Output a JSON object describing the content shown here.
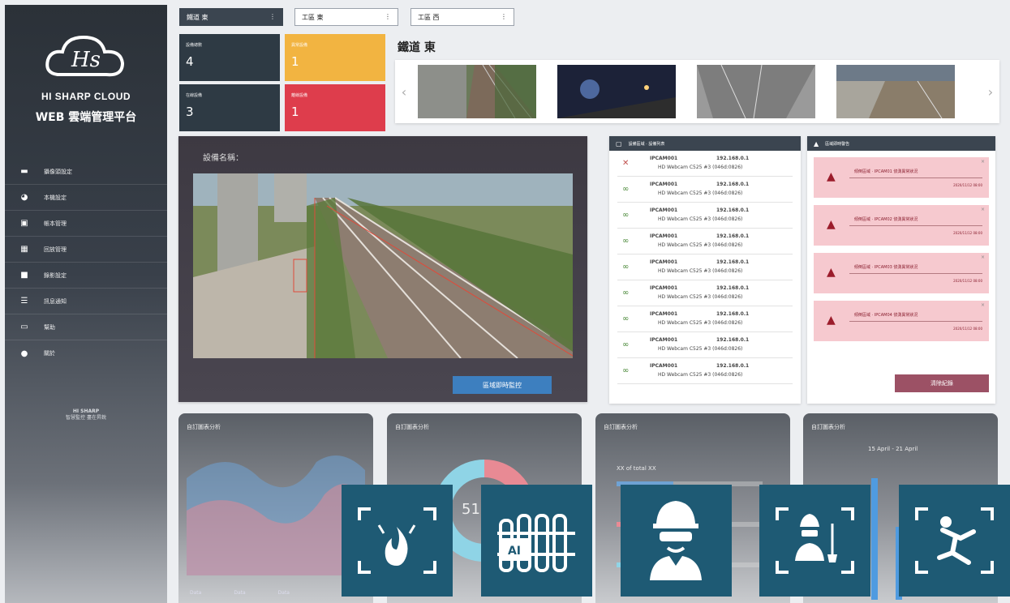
{
  "sidebar": {
    "brand": "HI SHARP CLOUD",
    "platform": "WEB 雲端管理平台",
    "menu": [
      {
        "label": "攝像頭設定",
        "icon": "camera-settings-icon"
      },
      {
        "label": "本機設定",
        "icon": "gauge-icon"
      },
      {
        "label": "帳本管理",
        "icon": "inbox-icon"
      },
      {
        "label": "回放管理",
        "icon": "image-icon"
      },
      {
        "label": "錄影設定",
        "icon": "video-camera-icon"
      },
      {
        "label": "訊息通知",
        "icon": "list-icon"
      },
      {
        "label": "幫助",
        "icon": "help-icon"
      },
      {
        "label": "關於",
        "icon": "info-icon"
      }
    ],
    "footer_brand": "HI SHARP",
    "footer_sub": "智慧監控 盡在昇銳"
  },
  "filters": {
    "f1": "鐵道 東",
    "f2": "工區 東",
    "f3": "工區 西"
  },
  "tiles": [
    {
      "label": "設備總數",
      "value": "4",
      "color": "#2e3a44"
    },
    {
      "label": "異常設備",
      "value": "1",
      "color": "#f2b441"
    },
    {
      "label": "在線設備",
      "value": "3",
      "color": "#2e3a44"
    },
    {
      "label": "離線設備",
      "value": "1",
      "color": "#de3d4c"
    }
  ],
  "section_title": "鐵道 東",
  "video": {
    "device_label": "設備名稱：",
    "monitor_button": "區域即時監控"
  },
  "devices": {
    "header": "設備區域 · 設備列表",
    "rows": [
      {
        "name": "IPCAM001",
        "ip": "192.168.0.1",
        "desc": "HD Webcam C525 #3 (046d:0826)",
        "status": "offline"
      },
      {
        "name": "IPCAM001",
        "ip": "192.168.0.1",
        "desc": "HD Webcam C525 #3 (046d:0826)",
        "status": "online"
      },
      {
        "name": "IPCAM001",
        "ip": "192.168.0.1",
        "desc": "HD Webcam C525 #3 (046d:0826)",
        "status": "online"
      },
      {
        "name": "IPCAM001",
        "ip": "192.168.0.1",
        "desc": "HD Webcam C525 #3 (046d:0826)",
        "status": "online"
      },
      {
        "name": "IPCAM001",
        "ip": "192.168.0.1",
        "desc": "HD Webcam C525 #3 (046d:0826)",
        "status": "online"
      },
      {
        "name": "IPCAM001",
        "ip": "192.168.0.1",
        "desc": "HD Webcam C525 #3 (046d:0826)",
        "status": "online"
      },
      {
        "name": "IPCAM001",
        "ip": "192.168.0.1",
        "desc": "HD Webcam C525 #3 (046d:0826)",
        "status": "online"
      },
      {
        "name": "IPCAM001",
        "ip": "192.168.0.1",
        "desc": "HD Webcam C525 #3 (046d:0826)",
        "status": "online"
      },
      {
        "name": "IPCAM001",
        "ip": "192.168.0.1",
        "desc": "HD Webcam C525 #3 (046d:0826)",
        "status": "online"
      }
    ]
  },
  "alerts": {
    "header": "區域即時警告",
    "items": [
      {
        "text": "傾倒區域 · IPCAM01 偵測異常狀況",
        "time": "2020/11/12 08:00"
      },
      {
        "text": "傾倒區域 · IPCAM02 偵測異常狀況",
        "time": "2020/11/12 08:00"
      },
      {
        "text": "傾倒區域 · IPCAM03 偵測異常狀況",
        "time": "2020/11/12 08:00"
      },
      {
        "text": "傾倒區域 · IPCAM04 偵測異常狀況",
        "time": "2020/11/12 08:00"
      }
    ],
    "clear_button": "清除紀錄"
  },
  "charts": [
    {
      "title": "自訂圖表分析"
    },
    {
      "title": "自訂圖表分析",
      "center_value": "51"
    },
    {
      "title": "自訂圖表分析",
      "subtitle": "XX of total XX"
    },
    {
      "title": "自訂圖表分析",
      "range": "15 April - 21 April"
    }
  ],
  "legend": [
    "Data",
    "Data",
    "Data"
  ],
  "features": [
    {
      "icon": "fire-detection-icon"
    },
    {
      "icon": "ai-fence-icon"
    },
    {
      "icon": "safety-helmet-worker-icon"
    },
    {
      "icon": "worker-ppe-detection-icon"
    },
    {
      "icon": "fall-detection-icon"
    }
  ],
  "colors": {
    "sidebar": "#2b3138",
    "accent_blue": "#3d7fbf",
    "warning": "#f2b441",
    "danger": "#de3d4c",
    "feature_bg": "#1e5a74"
  }
}
